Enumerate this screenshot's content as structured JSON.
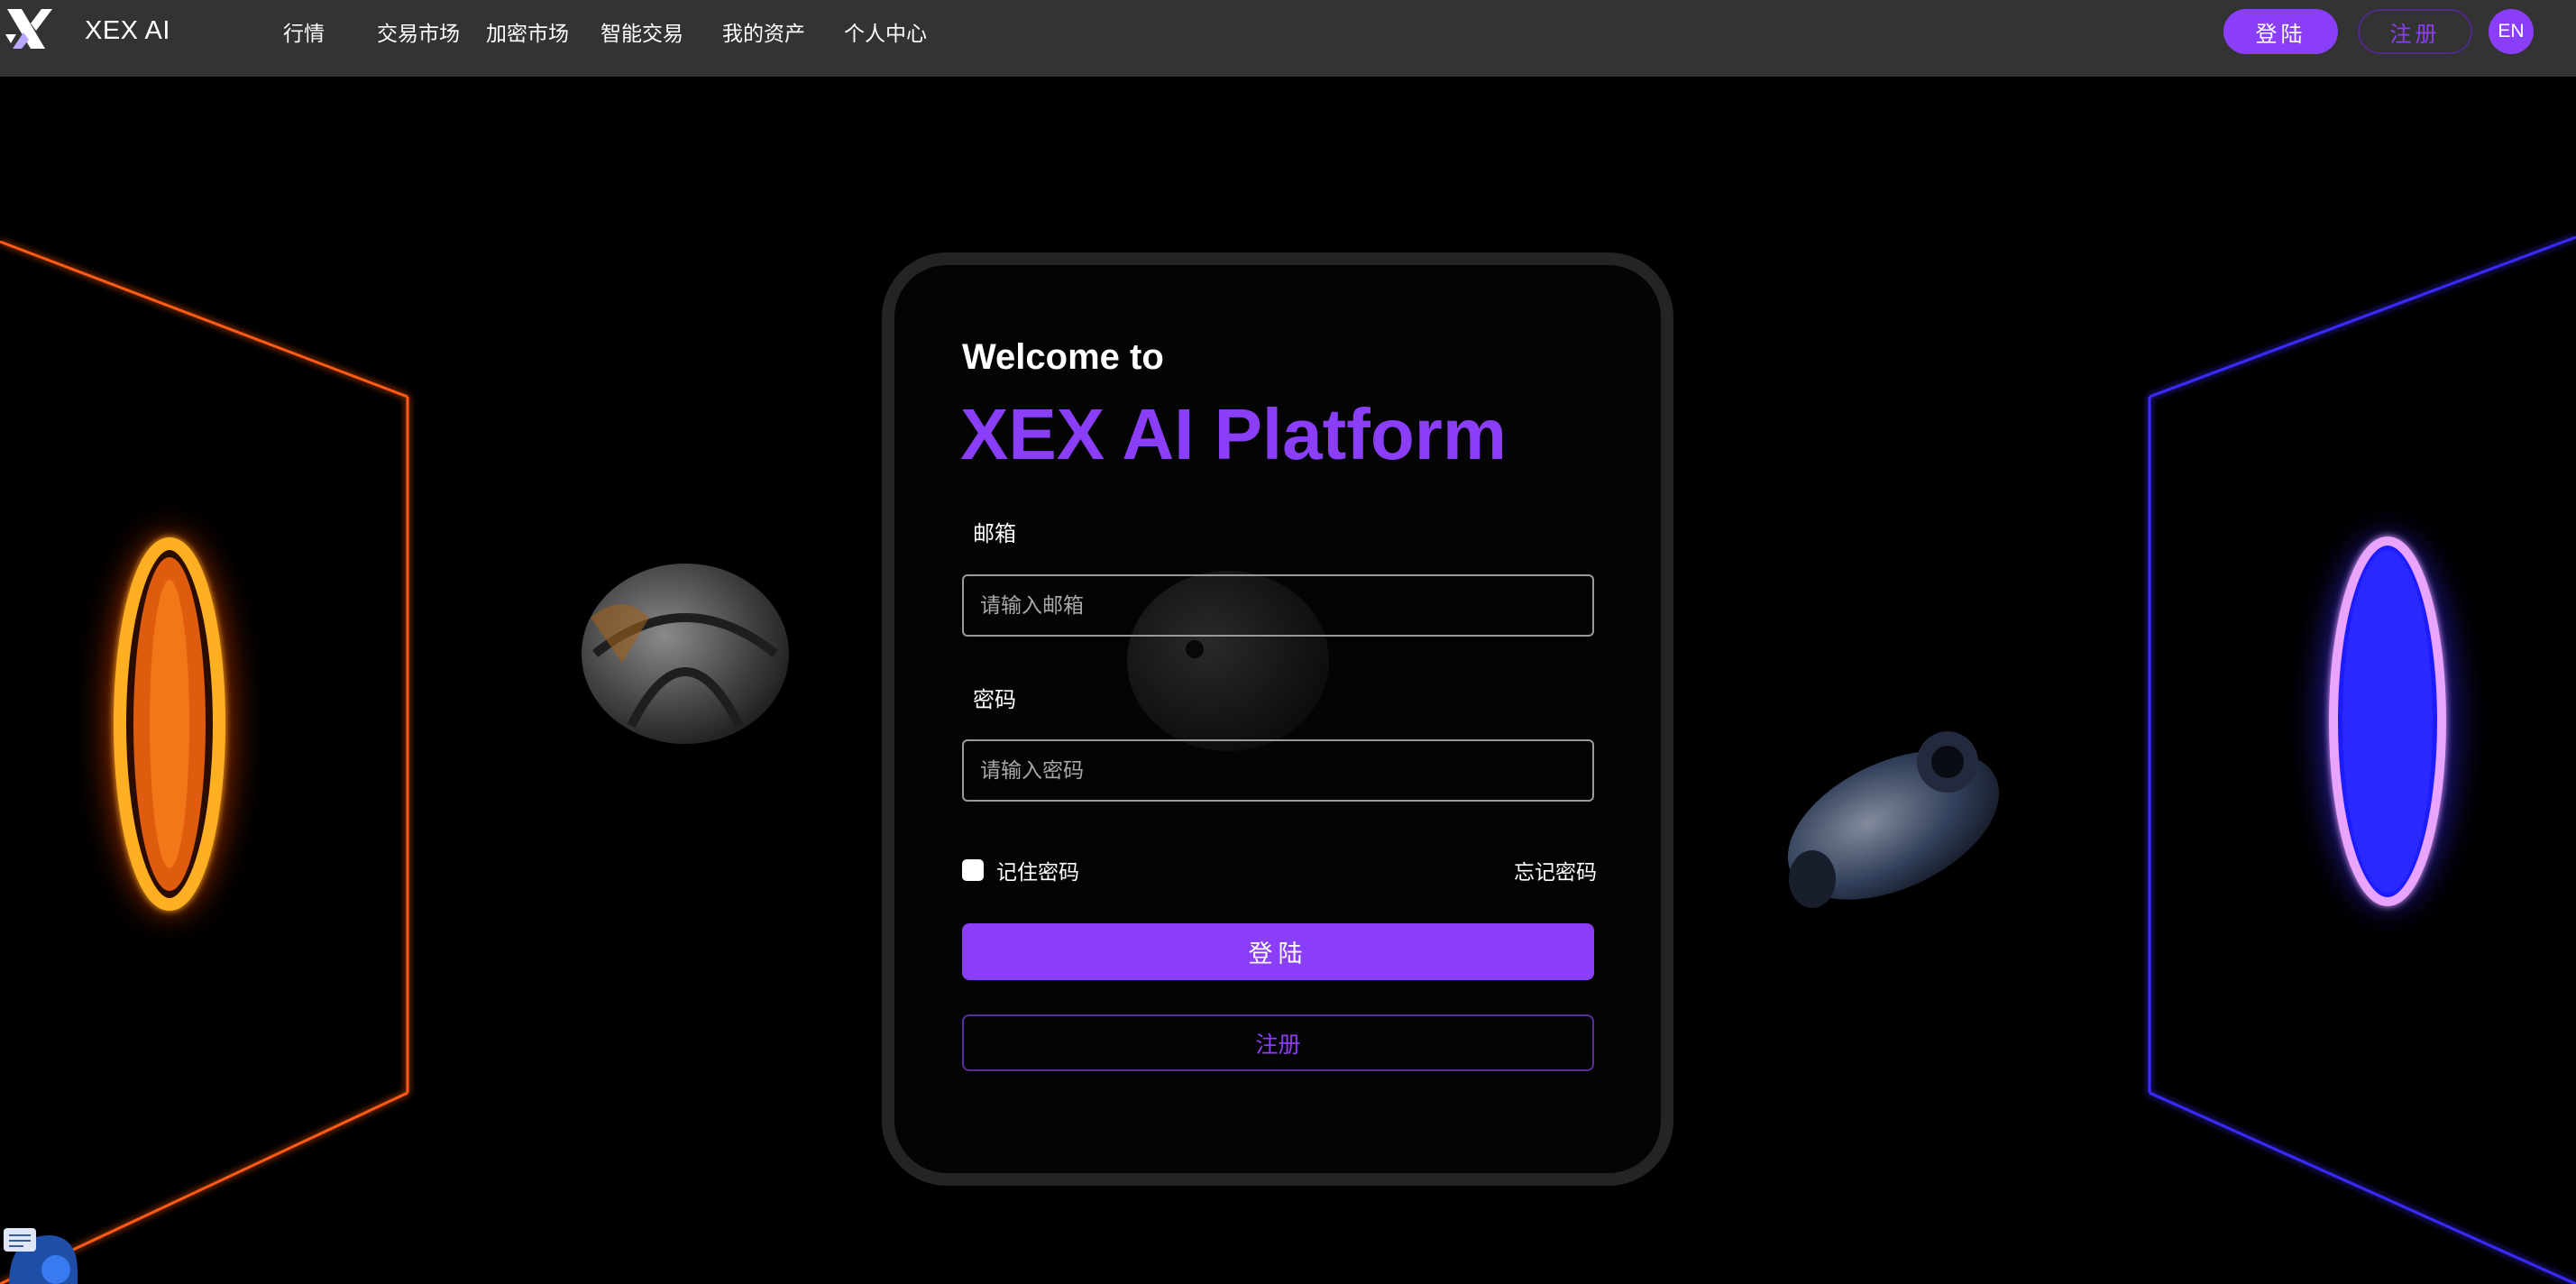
{
  "header": {
    "brand": "XEX AI",
    "nav": [
      "行情",
      "交易市场",
      "加密市场",
      "智能交易",
      "我的资产",
      "个人中心"
    ],
    "login_label": "登陆",
    "register_label": "注册",
    "lang_label": "EN"
  },
  "login_card": {
    "welcome": "Welcome to",
    "platform": "XEX AI Platform",
    "email_label": "邮箱",
    "email_placeholder": "请输入邮箱",
    "email_value": "",
    "password_label": "密码",
    "password_placeholder": "请输入密码",
    "password_value": "",
    "remember_label": "记住密码",
    "remember_checked": false,
    "forgot_label": "忘记密码",
    "submit_label": "登陆",
    "register_label": "注册"
  },
  "colors": {
    "accent": "#8a3ef7",
    "topbar": "#333333",
    "left_glow": "#ff5a14",
    "right_glow": "#4a2cff"
  },
  "icons": {
    "logo": "xex-logo-icon",
    "support": "customer-support-icon"
  }
}
